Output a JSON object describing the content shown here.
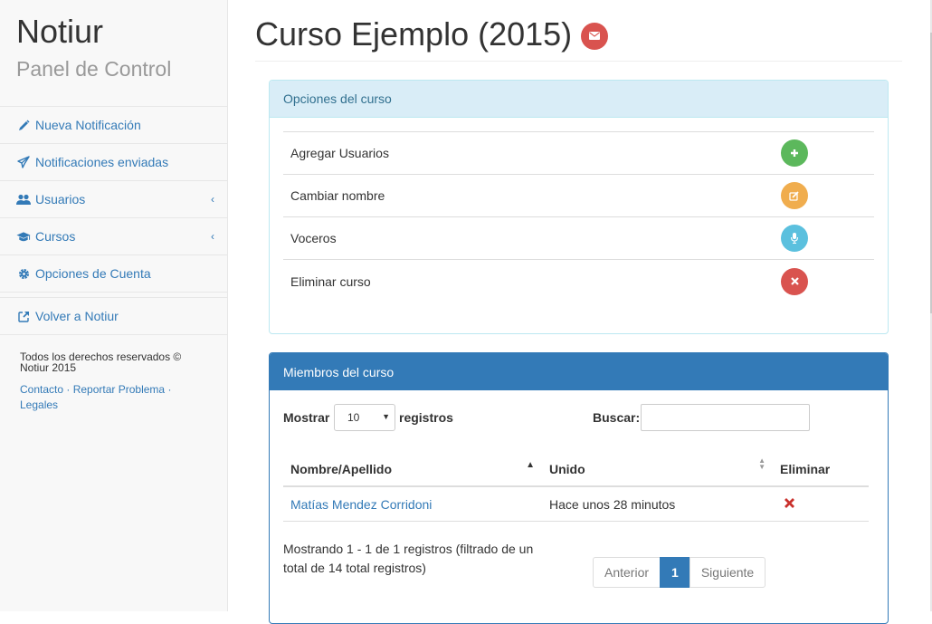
{
  "sidebar": {
    "brand_title": "Notiur",
    "brand_subtitle": "Panel de Control",
    "items": [
      {
        "label": "Nueva Notificación",
        "icon": "pencil-icon"
      },
      {
        "label": "Notificaciones enviadas",
        "icon": "paper-plane-icon"
      },
      {
        "label": "Usuarios",
        "icon": "users-icon",
        "chevron": "‹"
      },
      {
        "label": "Cursos",
        "icon": "graduation-cap-icon",
        "chevron": "‹"
      },
      {
        "label": "Opciones de Cuenta",
        "icon": "gear-icon"
      }
    ],
    "back_link": {
      "label": "Volver a Notiur",
      "icon": "external-link-icon"
    },
    "copyright": "Todos los derechos reservados © Notiur 2015",
    "footer_links": {
      "contact": "Contacto",
      "report": "Reportar Problema",
      "legal": "Legales",
      "sep": "·"
    }
  },
  "page": {
    "title": "Curso Ejemplo (2015)"
  },
  "options_panel": {
    "heading": "Opciones del curso",
    "rows": [
      {
        "label": "Agregar Usuarios",
        "icon": "plus-icon",
        "color": "#5cb85c"
      },
      {
        "label": "Cambiar nombre",
        "icon": "edit-icon",
        "color": "#f0ad4e"
      },
      {
        "label": "Voceros",
        "icon": "microphone-icon",
        "color": "#5bc0de"
      },
      {
        "label": "Eliminar curso",
        "icon": "times-icon",
        "color": "#d9534f"
      }
    ]
  },
  "members_panel": {
    "heading": "Miembros del curso",
    "length_prefix": "Mostrar",
    "length_value": "10",
    "length_suffix": "registros",
    "search_label": "Buscar:",
    "search_value": "",
    "columns": [
      "Nombre/Apellido",
      "Unido",
      "Eliminar"
    ],
    "rows": [
      {
        "name": "Matías Mendez Corridoni",
        "joined": "Hace unos 28 minutos"
      }
    ],
    "info": "Mostrando 1 - 1 de 1 registros (filtrado de un total de 14 total registros)",
    "pagination": {
      "prev": "Anterior",
      "current": "1",
      "next": "Siguiente"
    }
  },
  "colors": {
    "link": "#337ab7",
    "danger": "#d9534f",
    "success": "#5cb85c",
    "warning": "#f0ad4e",
    "info": "#5bc0de"
  }
}
